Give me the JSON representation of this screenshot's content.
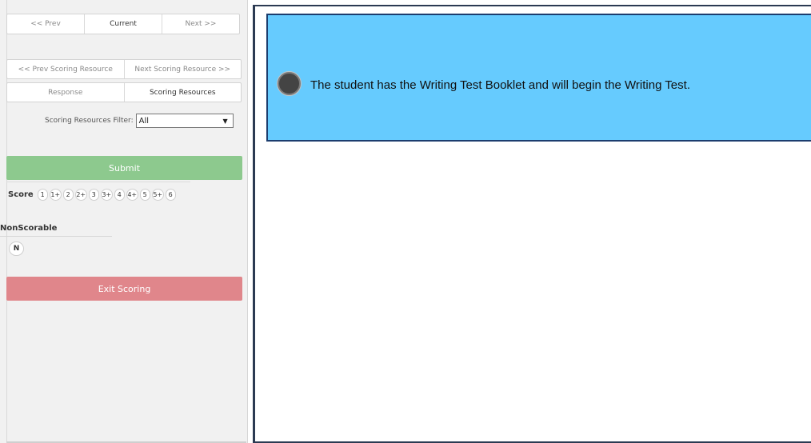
{
  "nav": {
    "prev": "<< Prev",
    "current": "Current",
    "next": "Next >>"
  },
  "resource_nav": {
    "prev": "<< Prev Scoring Resource",
    "next": "Next Scoring Resource >>"
  },
  "tabs": {
    "response": "Response",
    "scoring_resources": "Scoring Resources"
  },
  "filter": {
    "label": "Scoring Resources Filter:",
    "value": "All"
  },
  "submit_label": "Submit",
  "score": {
    "label": "Score",
    "options": [
      "1",
      "1+",
      "2",
      "2+",
      "3",
      "3+",
      "4",
      "4+",
      "5",
      "5+",
      "6"
    ]
  },
  "nonscorable": {
    "label": "NonScorable",
    "option": "N"
  },
  "exit_label": "Exit Scoring",
  "content": {
    "option_text": "The student has the Writing Test Booklet and will begin the Writing Test."
  },
  "colors": {
    "submit": "#8dc98e",
    "exit": "#e0868b",
    "question_bg": "#66cbfe",
    "question_border": "#1c3d6e"
  }
}
